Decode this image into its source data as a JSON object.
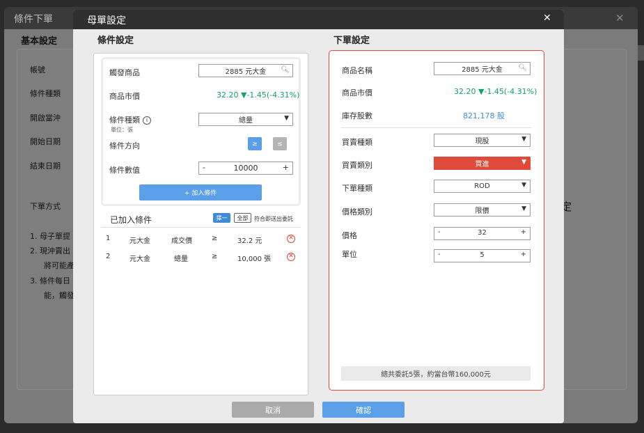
{
  "background": {
    "title": "條件下單",
    "section": "基本設定",
    "labels": [
      "帳號",
      "條件種類",
      "開啟當沖",
      "開始日期",
      "結束日期",
      "下單方式"
    ],
    "notes": [
      "1.  母子單提",
      "2.  現沖賣出",
      "將可能產",
      "3.  條件每日",
      "能，觸發"
    ],
    "right_char": "定"
  },
  "modal": {
    "title": "母單設定",
    "close": "✕"
  },
  "condition": {
    "title": "條件設定",
    "trigger_label": "觸發商品",
    "trigger_value": "2885 元大金",
    "price_label": "商品市價",
    "price_value": "32.20",
    "price_change": "▼-1.45(-4.31%)",
    "type_label": "條件種類",
    "type_unit": "單位：張",
    "type_value": "總量",
    "direction_label": "條件方向",
    "dir_ge": "≥",
    "dir_le": "≤",
    "value_label": "條件數值",
    "value": "10000",
    "add_button": "+ 加入條件",
    "added_title": "已加入條件",
    "tag_any": "擇一",
    "tag_all": "全部",
    "tag_desc": "符合即送出委託",
    "rows": [
      {
        "no": "1",
        "product": "元大金",
        "field": "成交價",
        "op": "≥",
        "value": "32.2 元"
      },
      {
        "no": "2",
        "product": "元大金",
        "field": "總量",
        "op": "≥",
        "value": "10,000 張"
      }
    ]
  },
  "order": {
    "title": "下單設定",
    "name_label": "商品名稱",
    "name_value": "2885 元大金",
    "price_label": "商品市價",
    "price_value": "32.20",
    "price_change": "▼-1.45(-4.31%)",
    "stock_label": "庫存股數",
    "stock_value": "821,178 股",
    "trade_type_label": "買賣種類",
    "trade_type_value": "現股",
    "side_label": "買賣類別",
    "side_value": "買進",
    "order_type_label": "下單種類",
    "order_type_value": "ROD",
    "price_type_label": "價格類別",
    "price_type_value": "限價",
    "price_input_label": "價格",
    "price_input_value": "32",
    "unit_label": "單位",
    "unit_value": "5",
    "summary": "總共委託5張，約當台幣160,000元"
  },
  "footer": {
    "cancel": "取消",
    "confirm": "確認"
  },
  "colors": {
    "accent_blue": "#5a9fe8",
    "buy_red": "#e04a3a",
    "up_down_green": "#18a06c"
  }
}
